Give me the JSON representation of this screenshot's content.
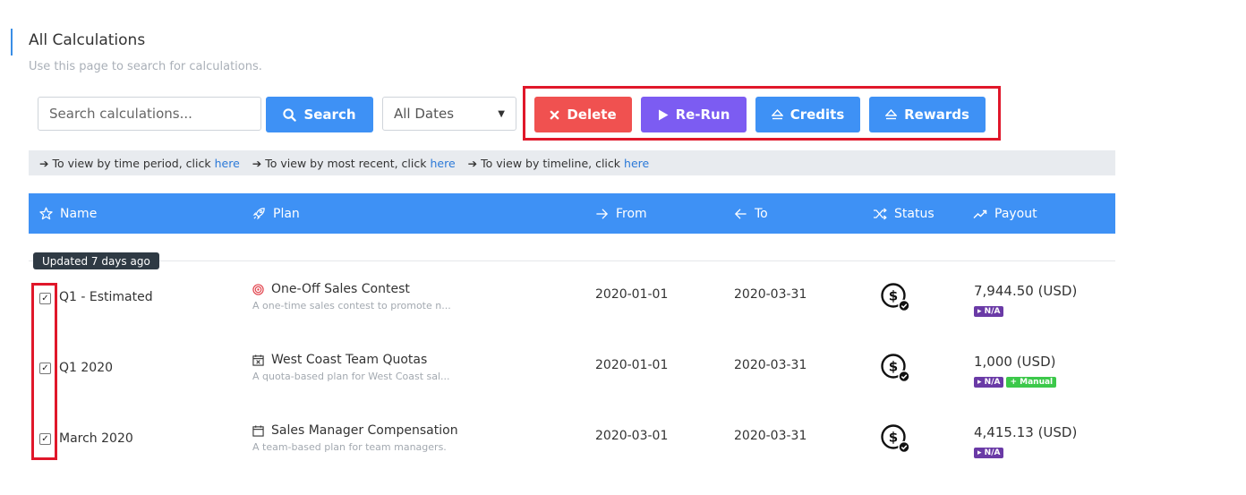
{
  "page": {
    "title": "All Calculations",
    "subtitle": "Use this page to search for calculations."
  },
  "search": {
    "placeholder": "Search calculations...",
    "button_label": "Search"
  },
  "date_filter": {
    "selected": "All Dates"
  },
  "actions": {
    "delete_label": "Delete",
    "rerun_label": "Re-Run",
    "credits_label": "Credits",
    "rewards_label": "Rewards"
  },
  "info_bar": [
    {
      "text": "To view by time period, click ",
      "link": "here"
    },
    {
      "text": "To view by most recent, click ",
      "link": "here"
    },
    {
      "text": "To view by timeline, click ",
      "link": "here"
    }
  ],
  "table": {
    "columns": [
      "Name",
      "Plan",
      "From",
      "To",
      "Status",
      "Payout"
    ],
    "updated_badge": "Updated 7 days ago",
    "rows": [
      {
        "name": "Q1 - Estimated",
        "plan_name": "One-Off Sales Contest",
        "plan_desc": "A one-time sales contest to promote n...",
        "plan_icon": "target-icon",
        "from": "2020-01-01",
        "to": "2020-03-31",
        "payout": "7,944.50 (USD)",
        "tags": [
          "N/A"
        ]
      },
      {
        "name": "Q1 2020",
        "plan_name": "West Coast Team Quotas",
        "plan_desc": "A quota-based plan for West Coast sal...",
        "plan_icon": "calendar-x-icon",
        "from": "2020-01-01",
        "to": "2020-03-31",
        "payout": "1,000 (USD)",
        "tags": [
          "N/A",
          "+ Manual"
        ]
      },
      {
        "name": "March 2020",
        "plan_name": "Sales Manager Compensation",
        "plan_desc": "A team-based plan for team managers.",
        "plan_icon": "calendar-icon",
        "from": "2020-03-01",
        "to": "2020-03-31",
        "payout": "4,415.13 (USD)",
        "tags": [
          "N/A"
        ]
      }
    ]
  },
  "colors": {
    "primary": "#3e91f5",
    "danger": "#f05150",
    "purple": "#7c5cf2",
    "highlight_frame": "#e0172a",
    "tag_na": "#6a3aa6",
    "tag_manual": "#3cc84a"
  }
}
